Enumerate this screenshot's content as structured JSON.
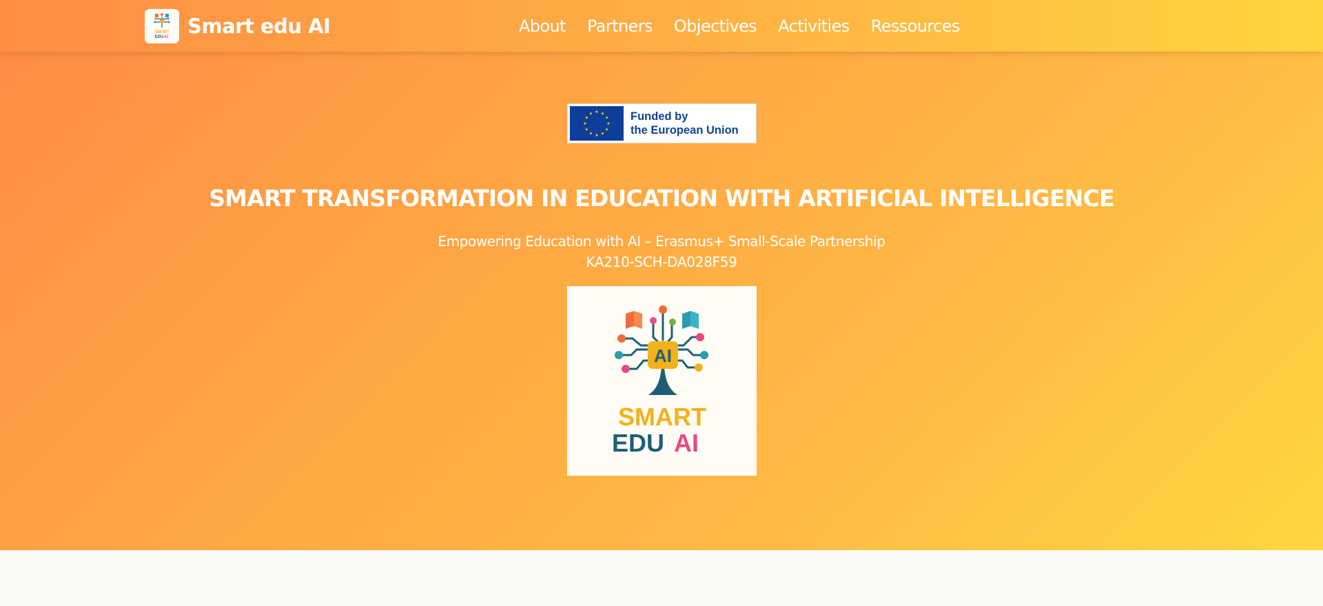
{
  "brand": {
    "name": "Smart edu AI",
    "logo_text_1": "SMART",
    "logo_text_2": "EDU",
    "logo_text_3": "AI"
  },
  "nav": {
    "items": [
      {
        "label": "About"
      },
      {
        "label": "Partners"
      },
      {
        "label": "Objectives"
      },
      {
        "label": "Activities"
      },
      {
        "label": "Ressources"
      }
    ]
  },
  "eu_badge": {
    "line1": "Funded by",
    "line2": "the European Union"
  },
  "hero": {
    "title": "SMART TRANSFORMATION IN EDUCATION WITH ARTIFICIAL INTELLIGENCE",
    "subtitle": "Empowering Education with AI – Erasmus+ Small-Scale Partnership",
    "project_code": "KA210-SCH-DA028F59"
  },
  "project_logo": {
    "chip_text": "AI",
    "word1": "SMART",
    "word2": "EDU",
    "word3": "AI"
  },
  "colors": {
    "gradient_start": "#ff8b44",
    "gradient_end": "#ffd640",
    "eu_blue": "#0e3e9a",
    "eu_text": "#104393",
    "logo_yellow": "#f2b21a",
    "logo_teal": "#1e5f74",
    "logo_pink": "#e84a84"
  },
  "icons": {
    "brand_logo": "smart-edu-ai-tree-logo",
    "eu_flag": "eu-flag-icon",
    "project_logo": "ai-tree-logo"
  }
}
